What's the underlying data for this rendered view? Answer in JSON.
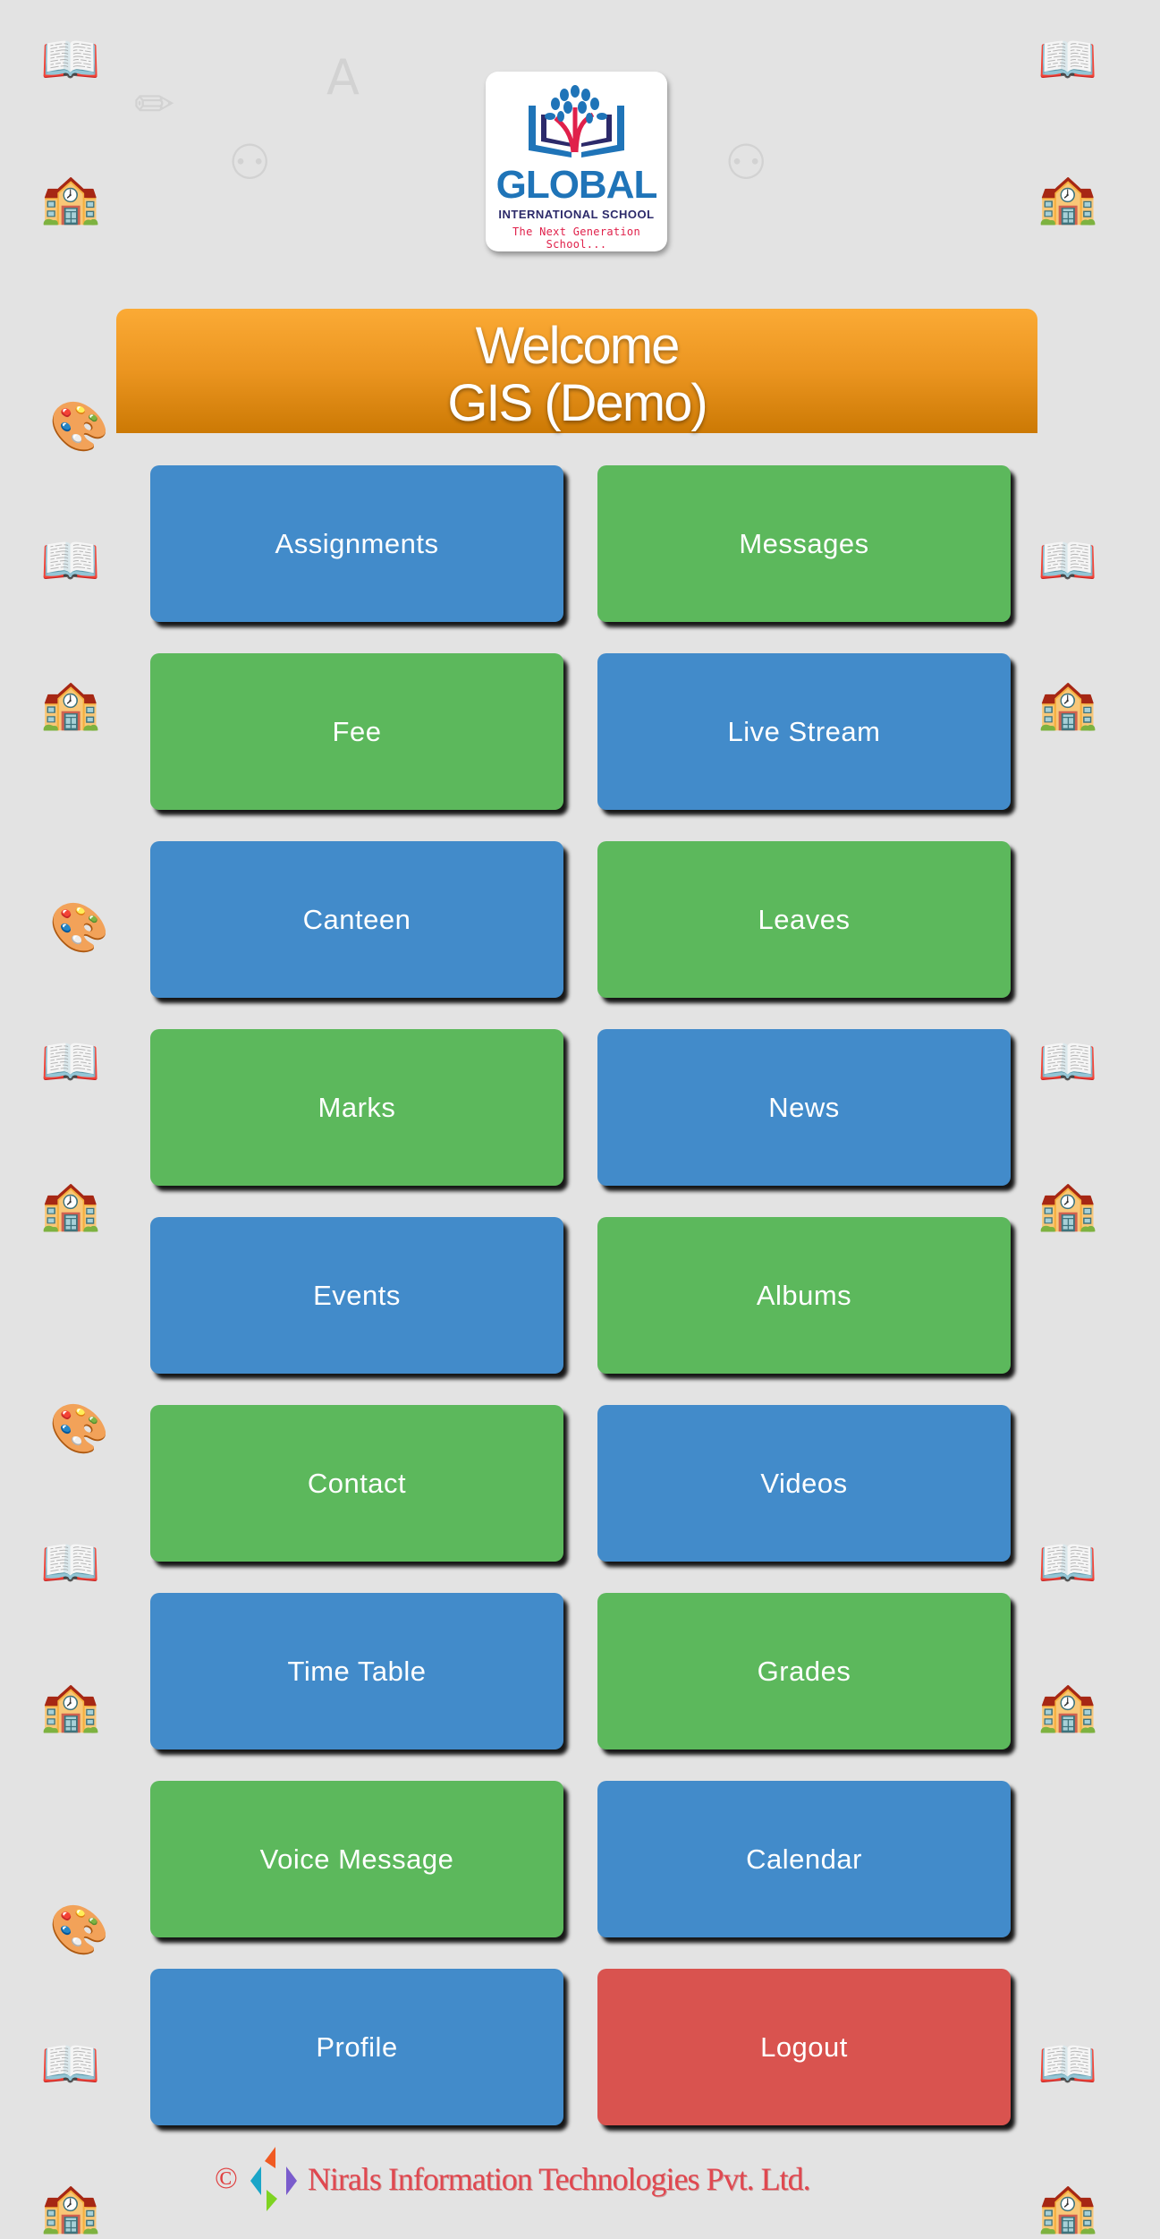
{
  "logo": {
    "brand": "GLOBAL",
    "subtitle": "INTERNATIONAL SCHOOL",
    "tagline": "The Next Generation School..."
  },
  "welcome": {
    "line1": "Welcome",
    "line2": "GIS (Demo)"
  },
  "menu": [
    {
      "label": "Assignments",
      "color": "#428bca"
    },
    {
      "label": "Messages",
      "color": "#5cb85c"
    },
    {
      "label": "Fee",
      "color": "#5cb85c"
    },
    {
      "label": "Live Stream",
      "color": "#428bca"
    },
    {
      "label": "Canteen",
      "color": "#428bca"
    },
    {
      "label": "Leaves",
      "color": "#5cb85c"
    },
    {
      "label": "Marks",
      "color": "#5cb85c"
    },
    {
      "label": "News",
      "color": "#428bca"
    },
    {
      "label": "Events",
      "color": "#428bca"
    },
    {
      "label": "Albums",
      "color": "#5cb85c"
    },
    {
      "label": "Contact",
      "color": "#5cb85c"
    },
    {
      "label": "Videos",
      "color": "#428bca"
    },
    {
      "label": "Time Table",
      "color": "#428bca"
    },
    {
      "label": "Grades",
      "color": "#5cb85c"
    },
    {
      "label": "Voice Message",
      "color": "#5cb85c"
    },
    {
      "label": "Calendar",
      "color": "#428bca"
    },
    {
      "label": "Profile",
      "color": "#428bca"
    },
    {
      "label": "Logout",
      "color": "#d9534f"
    }
  ],
  "footer": {
    "copyright_symbol": "©",
    "company": "Nirals Information Technologies Pvt. Ltd."
  },
  "colors": {
    "background": "#e3e3e3",
    "header_orange": "#eb9520",
    "blue": "#428bca",
    "green": "#5cb85c",
    "red": "#d9534f"
  }
}
